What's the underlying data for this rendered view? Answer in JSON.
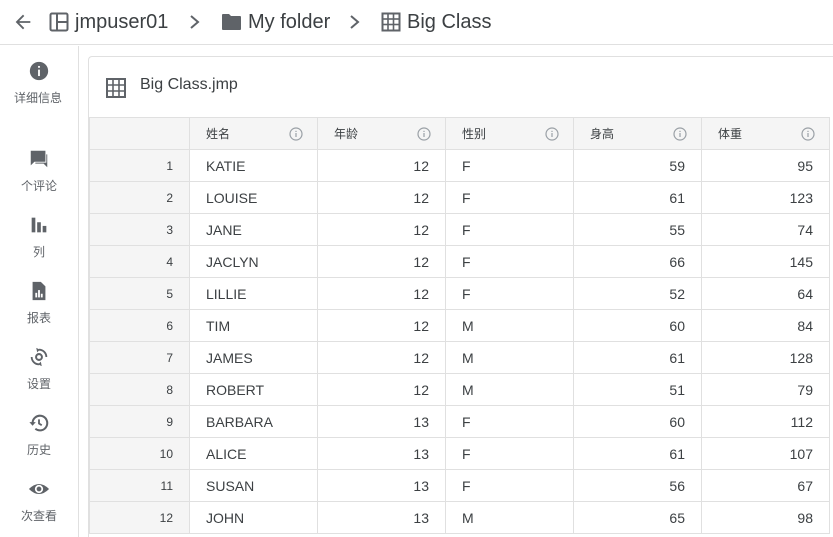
{
  "breadcrumb": {
    "back_icon": "arrow-left-icon",
    "items": [
      {
        "label": "jmpuser01",
        "icon": "workspace-icon"
      },
      {
        "label": "My folder",
        "icon": "folder-icon"
      },
      {
        "label": "Big Class",
        "icon": "table-icon"
      }
    ]
  },
  "sidebar": {
    "items": [
      {
        "label": "详细信息",
        "icon": "info-icon"
      },
      {
        "label": "个评论",
        "icon": "comment-icon"
      },
      {
        "label": "列",
        "icon": "bar-chart-icon"
      },
      {
        "label": "报表",
        "icon": "report-icon"
      },
      {
        "label": "设置",
        "icon": "settings-sync-icon"
      },
      {
        "label": "历史",
        "icon": "history-icon"
      },
      {
        "label": "次查看",
        "icon": "eye-icon"
      }
    ]
  },
  "panel": {
    "title": "Big Class.jmp",
    "icon": "table-icon"
  },
  "table": {
    "columns": [
      "姓名",
      "年龄",
      "性别",
      "身高",
      "体重"
    ],
    "rows": [
      {
        "n": "1",
        "name": "KATIE",
        "age": "12",
        "sex": "F",
        "height": "59",
        "weight": "95"
      },
      {
        "n": "2",
        "name": "LOUISE",
        "age": "12",
        "sex": "F",
        "height": "61",
        "weight": "123"
      },
      {
        "n": "3",
        "name": "JANE",
        "age": "12",
        "sex": "F",
        "height": "55",
        "weight": "74"
      },
      {
        "n": "4",
        "name": "JACLYN",
        "age": "12",
        "sex": "F",
        "height": "66",
        "weight": "145"
      },
      {
        "n": "5",
        "name": "LILLIE",
        "age": "12",
        "sex": "F",
        "height": "52",
        "weight": "64"
      },
      {
        "n": "6",
        "name": "TIM",
        "age": "12",
        "sex": "M",
        "height": "60",
        "weight": "84"
      },
      {
        "n": "7",
        "name": "JAMES",
        "age": "12",
        "sex": "M",
        "height": "61",
        "weight": "128"
      },
      {
        "n": "8",
        "name": "ROBERT",
        "age": "12",
        "sex": "M",
        "height": "51",
        "weight": "79"
      },
      {
        "n": "9",
        "name": "BARBARA",
        "age": "13",
        "sex": "F",
        "height": "60",
        "weight": "112"
      },
      {
        "n": "10",
        "name": "ALICE",
        "age": "13",
        "sex": "F",
        "height": "61",
        "weight": "107"
      },
      {
        "n": "11",
        "name": "SUSAN",
        "age": "13",
        "sex": "F",
        "height": "56",
        "weight": "67"
      },
      {
        "n": "12",
        "name": "JOHN",
        "age": "13",
        "sex": "M",
        "height": "65",
        "weight": "98"
      }
    ]
  }
}
